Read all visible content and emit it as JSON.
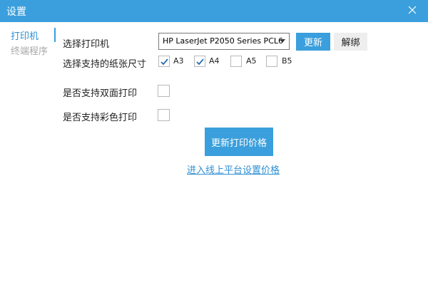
{
  "window": {
    "title": "设置",
    "close_icon": "close-icon"
  },
  "colors": {
    "accent": "#3a9fdc",
    "link": "#2f8fd2",
    "sidebar_inactive": "#a8a8a8"
  },
  "sidebar": {
    "items": [
      {
        "label": "打印机",
        "active": true
      },
      {
        "label": "终端程序",
        "active": false
      }
    ]
  },
  "printer": {
    "label": "选择打印机",
    "selected": "HP LaserJet P2050 Series PCL6",
    "refresh_label": "更新",
    "unbind_label": "解绑"
  },
  "paper_sizes": {
    "label": "选择支持的纸张尺寸",
    "options": [
      {
        "name": "A3",
        "checked": true
      },
      {
        "name": "A4",
        "checked": true
      },
      {
        "name": "A5",
        "checked": false
      },
      {
        "name": "B5",
        "checked": false
      }
    ]
  },
  "duplex": {
    "label": "是否支持双面打印",
    "checked": false
  },
  "color_print": {
    "label": "是否支持彩色打印",
    "checked": false
  },
  "actions": {
    "update_price_label": "更新打印价格",
    "online_link_label": "进入线上平台设置价格"
  }
}
